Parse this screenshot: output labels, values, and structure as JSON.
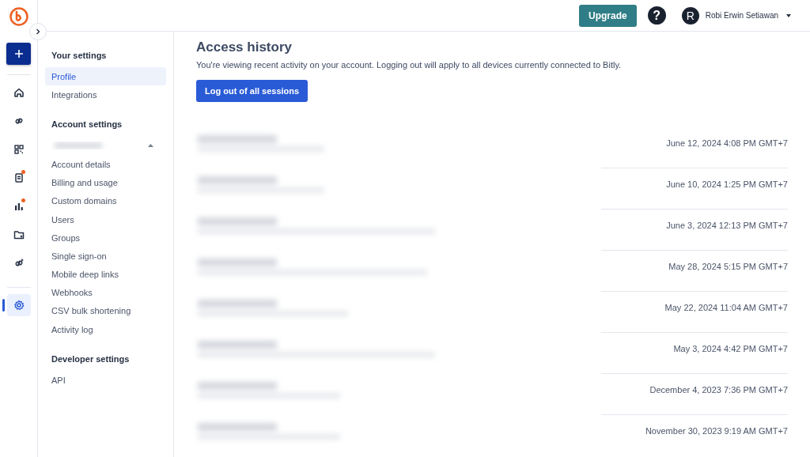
{
  "rail": {
    "items": [
      {
        "kind": "home",
        "dot": false,
        "selected": false
      },
      {
        "kind": "link",
        "dot": false,
        "selected": false
      },
      {
        "kind": "qr",
        "dot": false,
        "selected": false
      },
      {
        "kind": "page",
        "dot": true,
        "selected": false
      },
      {
        "kind": "chart",
        "dot": true,
        "selected": false
      },
      {
        "kind": "folder",
        "dot": false,
        "selected": false
      },
      {
        "kind": "linkplus",
        "dot": false,
        "selected": false
      },
      {
        "kind": "gear",
        "dot": false,
        "selected": true
      }
    ]
  },
  "top_bar": {
    "upgrade": "Upgrade",
    "help": "?",
    "avatar": "R",
    "user": "Robi Erwin Setiawan"
  },
  "sidebar": {
    "sections": [
      {
        "title": "Your settings",
        "items": [
          {
            "label": "Profile",
            "selected": true
          },
          {
            "label": "Integrations",
            "selected": false
          }
        ]
      },
      {
        "title": "Account settings",
        "account_dropdown": true,
        "items": [
          {
            "label": "Account details",
            "selected": false
          },
          {
            "label": "Billing and usage",
            "selected": false
          },
          {
            "label": "Custom domains",
            "selected": false
          },
          {
            "label": "Users",
            "selected": false
          },
          {
            "label": "Groups",
            "selected": false
          },
          {
            "label": "Single sign-on",
            "selected": false
          },
          {
            "label": "Mobile deep links",
            "selected": false
          },
          {
            "label": "Webhooks",
            "selected": false
          },
          {
            "label": "CSV bulk shortening",
            "selected": false
          },
          {
            "label": "Activity log",
            "selected": false
          }
        ]
      },
      {
        "title": "Developer settings",
        "items": [
          {
            "label": "API",
            "selected": false
          }
        ]
      }
    ]
  },
  "main": {
    "title": "Access history",
    "description": "You're viewing recent activity on your account. Logging out will apply to all devices currently connected to Bitly.",
    "button": "Log out of all sessions",
    "sessions": [
      {
        "time": "June 12, 2024 4:08 PM GMT+7"
      },
      {
        "time": "June 10, 2024 1:25 PM GMT+7"
      },
      {
        "time": "June 3, 2024 12:13 PM GMT+7"
      },
      {
        "time": "May 28, 2024 5:15 PM GMT+7"
      },
      {
        "time": "May 22, 2024 11:04 AM GMT+7"
      },
      {
        "time": "May 3, 2024 4:42 PM GMT+7"
      },
      {
        "time": "December 4, 2023 7:36 PM GMT+7"
      },
      {
        "time": "November 30, 2023 9:19 AM GMT+7"
      }
    ]
  }
}
